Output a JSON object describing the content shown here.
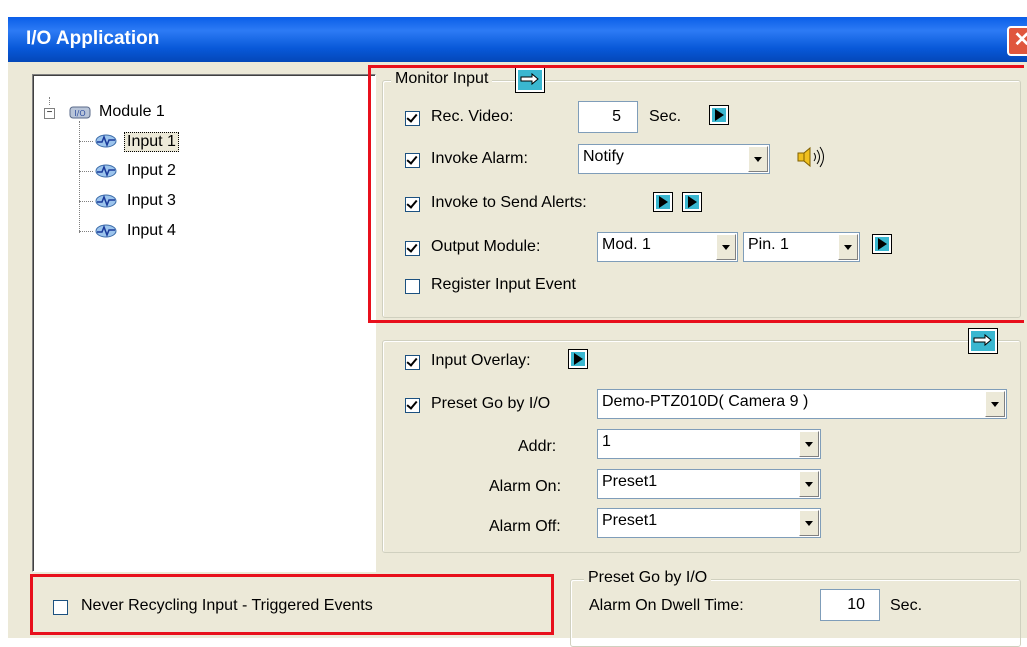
{
  "window": {
    "title": "I/O Application",
    "close_glyph": "✕"
  },
  "tree": {
    "module": "Module 1",
    "inputs": [
      "Input 1",
      "Input 2",
      "Input 3",
      "Input 4"
    ],
    "selected": "Input 1",
    "expander": "−"
  },
  "monitor": {
    "legend": "Monitor Input",
    "rec_video": {
      "label": "Rec. Video:",
      "checked": true,
      "value": "5",
      "unit": "Sec."
    },
    "invoke_alarm": {
      "label": "Invoke Alarm:",
      "checked": true,
      "value": "Notify"
    },
    "send_alerts": {
      "label": "Invoke to Send Alerts:",
      "checked": true
    },
    "output_module": {
      "label": "Output Module:",
      "checked": true,
      "module": "Mod. 1",
      "pin": "Pin. 1"
    },
    "register": {
      "label": "Register Input Event",
      "checked": false
    }
  },
  "overlay": {
    "input_overlay": {
      "label": "Input Overlay:",
      "checked": true
    },
    "preset_go": {
      "label": "Preset Go by I/O",
      "checked": true,
      "camera": "Demo-PTZ010D( Camera 9 )"
    },
    "addr": {
      "label": "Addr:",
      "value": "1"
    },
    "alarm_on": {
      "label": "Alarm On:",
      "value": "Preset1"
    },
    "alarm_off": {
      "label": "Alarm Off:",
      "value": "Preset1"
    }
  },
  "never_recycling": {
    "label": "Never Recycling Input - Triggered Events",
    "checked": false
  },
  "dwell": {
    "legend": "Preset Go by I/O",
    "label": "Alarm On Dwell Time:",
    "value": "10",
    "unit": "Sec."
  },
  "colors": {
    "title_bar": "#0a5ee8",
    "highlight": "#e8101c",
    "panel": "#ece9d8"
  }
}
